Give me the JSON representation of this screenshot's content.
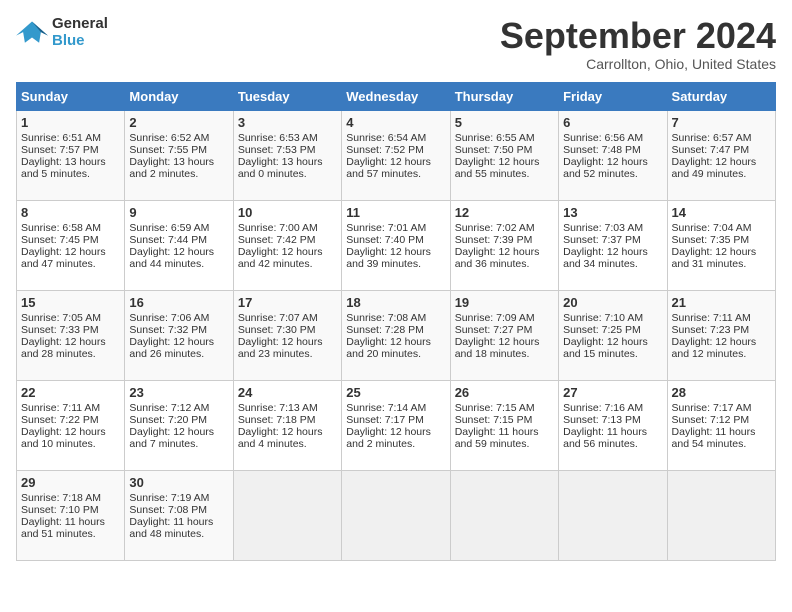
{
  "header": {
    "logo_line1": "General",
    "logo_line2": "Blue",
    "month": "September 2024",
    "location": "Carrollton, Ohio, United States"
  },
  "days_of_week": [
    "Sunday",
    "Monday",
    "Tuesday",
    "Wednesday",
    "Thursday",
    "Friday",
    "Saturday"
  ],
  "weeks": [
    [
      {
        "day": "1",
        "info": "Sunrise: 6:51 AM\nSunset: 7:57 PM\nDaylight: 13 hours and 5 minutes."
      },
      {
        "day": "2",
        "info": "Sunrise: 6:52 AM\nSunset: 7:55 PM\nDaylight: 13 hours and 2 minutes."
      },
      {
        "day": "3",
        "info": "Sunrise: 6:53 AM\nSunset: 7:53 PM\nDaylight: 13 hours and 0 minutes."
      },
      {
        "day": "4",
        "info": "Sunrise: 6:54 AM\nSunset: 7:52 PM\nDaylight: 12 hours and 57 minutes."
      },
      {
        "day": "5",
        "info": "Sunrise: 6:55 AM\nSunset: 7:50 PM\nDaylight: 12 hours and 55 minutes."
      },
      {
        "day": "6",
        "info": "Sunrise: 6:56 AM\nSunset: 7:48 PM\nDaylight: 12 hours and 52 minutes."
      },
      {
        "day": "7",
        "info": "Sunrise: 6:57 AM\nSunset: 7:47 PM\nDaylight: 12 hours and 49 minutes."
      }
    ],
    [
      {
        "day": "8",
        "info": "Sunrise: 6:58 AM\nSunset: 7:45 PM\nDaylight: 12 hours and 47 minutes."
      },
      {
        "day": "9",
        "info": "Sunrise: 6:59 AM\nSunset: 7:44 PM\nDaylight: 12 hours and 44 minutes."
      },
      {
        "day": "10",
        "info": "Sunrise: 7:00 AM\nSunset: 7:42 PM\nDaylight: 12 hours and 42 minutes."
      },
      {
        "day": "11",
        "info": "Sunrise: 7:01 AM\nSunset: 7:40 PM\nDaylight: 12 hours and 39 minutes."
      },
      {
        "day": "12",
        "info": "Sunrise: 7:02 AM\nSunset: 7:39 PM\nDaylight: 12 hours and 36 minutes."
      },
      {
        "day": "13",
        "info": "Sunrise: 7:03 AM\nSunset: 7:37 PM\nDaylight: 12 hours and 34 minutes."
      },
      {
        "day": "14",
        "info": "Sunrise: 7:04 AM\nSunset: 7:35 PM\nDaylight: 12 hours and 31 minutes."
      }
    ],
    [
      {
        "day": "15",
        "info": "Sunrise: 7:05 AM\nSunset: 7:33 PM\nDaylight: 12 hours and 28 minutes."
      },
      {
        "day": "16",
        "info": "Sunrise: 7:06 AM\nSunset: 7:32 PM\nDaylight: 12 hours and 26 minutes."
      },
      {
        "day": "17",
        "info": "Sunrise: 7:07 AM\nSunset: 7:30 PM\nDaylight: 12 hours and 23 minutes."
      },
      {
        "day": "18",
        "info": "Sunrise: 7:08 AM\nSunset: 7:28 PM\nDaylight: 12 hours and 20 minutes."
      },
      {
        "day": "19",
        "info": "Sunrise: 7:09 AM\nSunset: 7:27 PM\nDaylight: 12 hours and 18 minutes."
      },
      {
        "day": "20",
        "info": "Sunrise: 7:10 AM\nSunset: 7:25 PM\nDaylight: 12 hours and 15 minutes."
      },
      {
        "day": "21",
        "info": "Sunrise: 7:11 AM\nSunset: 7:23 PM\nDaylight: 12 hours and 12 minutes."
      }
    ],
    [
      {
        "day": "22",
        "info": "Sunrise: 7:11 AM\nSunset: 7:22 PM\nDaylight: 12 hours and 10 minutes."
      },
      {
        "day": "23",
        "info": "Sunrise: 7:12 AM\nSunset: 7:20 PM\nDaylight: 12 hours and 7 minutes."
      },
      {
        "day": "24",
        "info": "Sunrise: 7:13 AM\nSunset: 7:18 PM\nDaylight: 12 hours and 4 minutes."
      },
      {
        "day": "25",
        "info": "Sunrise: 7:14 AM\nSunset: 7:17 PM\nDaylight: 12 hours and 2 minutes."
      },
      {
        "day": "26",
        "info": "Sunrise: 7:15 AM\nSunset: 7:15 PM\nDaylight: 11 hours and 59 minutes."
      },
      {
        "day": "27",
        "info": "Sunrise: 7:16 AM\nSunset: 7:13 PM\nDaylight: 11 hours and 56 minutes."
      },
      {
        "day": "28",
        "info": "Sunrise: 7:17 AM\nSunset: 7:12 PM\nDaylight: 11 hours and 54 minutes."
      }
    ],
    [
      {
        "day": "29",
        "info": "Sunrise: 7:18 AM\nSunset: 7:10 PM\nDaylight: 11 hours and 51 minutes."
      },
      {
        "day": "30",
        "info": "Sunrise: 7:19 AM\nSunset: 7:08 PM\nDaylight: 11 hours and 48 minutes."
      },
      {
        "day": "",
        "info": ""
      },
      {
        "day": "",
        "info": ""
      },
      {
        "day": "",
        "info": ""
      },
      {
        "day": "",
        "info": ""
      },
      {
        "day": "",
        "info": ""
      }
    ]
  ]
}
